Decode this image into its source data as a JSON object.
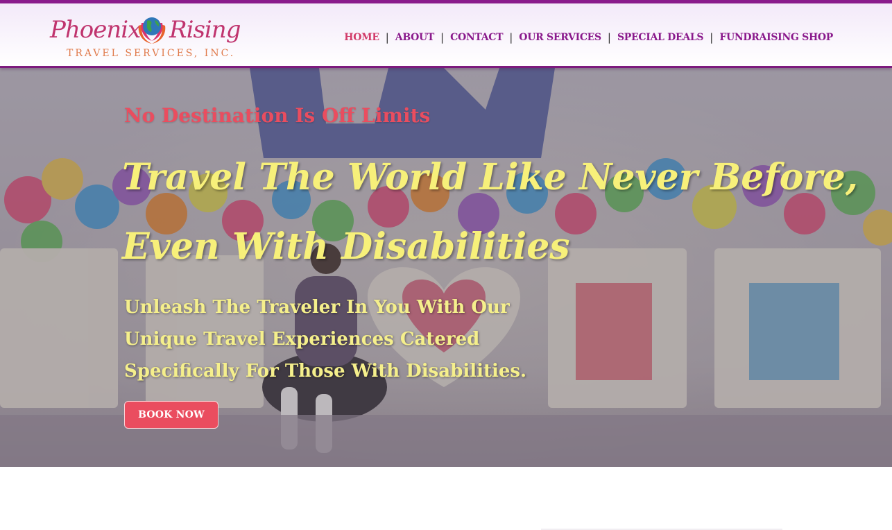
{
  "brand": {
    "name_part1": "Phoenix",
    "name_part2": "Rising",
    "subtitle": "TRAVEL SERVICES, INC."
  },
  "nav": {
    "items": [
      {
        "label": "HOME",
        "active": true
      },
      {
        "label": "ABOUT",
        "active": false
      },
      {
        "label": "CONTACT",
        "active": false
      },
      {
        "label": "OUR SERVICES",
        "active": false
      },
      {
        "label": "SPECIAL DEALS",
        "active": false
      },
      {
        "label": "FUNDRAISING SHOP",
        "active": false
      }
    ],
    "separator": "|"
  },
  "hero": {
    "tagline": "No Destination Is Off Limits",
    "headline_line1": "Travel The World Like Never Before,",
    "headline_line2": "Even With Disabilities",
    "subhead_line1": "Unleash The Traveler In You With Our",
    "subhead_line2": "Unique Travel Experiences Catered",
    "subhead_line3": "Specifically For Those With Disabilities.",
    "cta_label": "BOOK NOW"
  },
  "colors": {
    "brand_purple": "#8a1a8c",
    "accent_coral": "#ea4d5f",
    "headline_yellow": "#f7f07a",
    "active_nav": "#d23c6a"
  },
  "icons": {
    "logo_emblem": "globe-with-phoenix-hands-icon"
  }
}
